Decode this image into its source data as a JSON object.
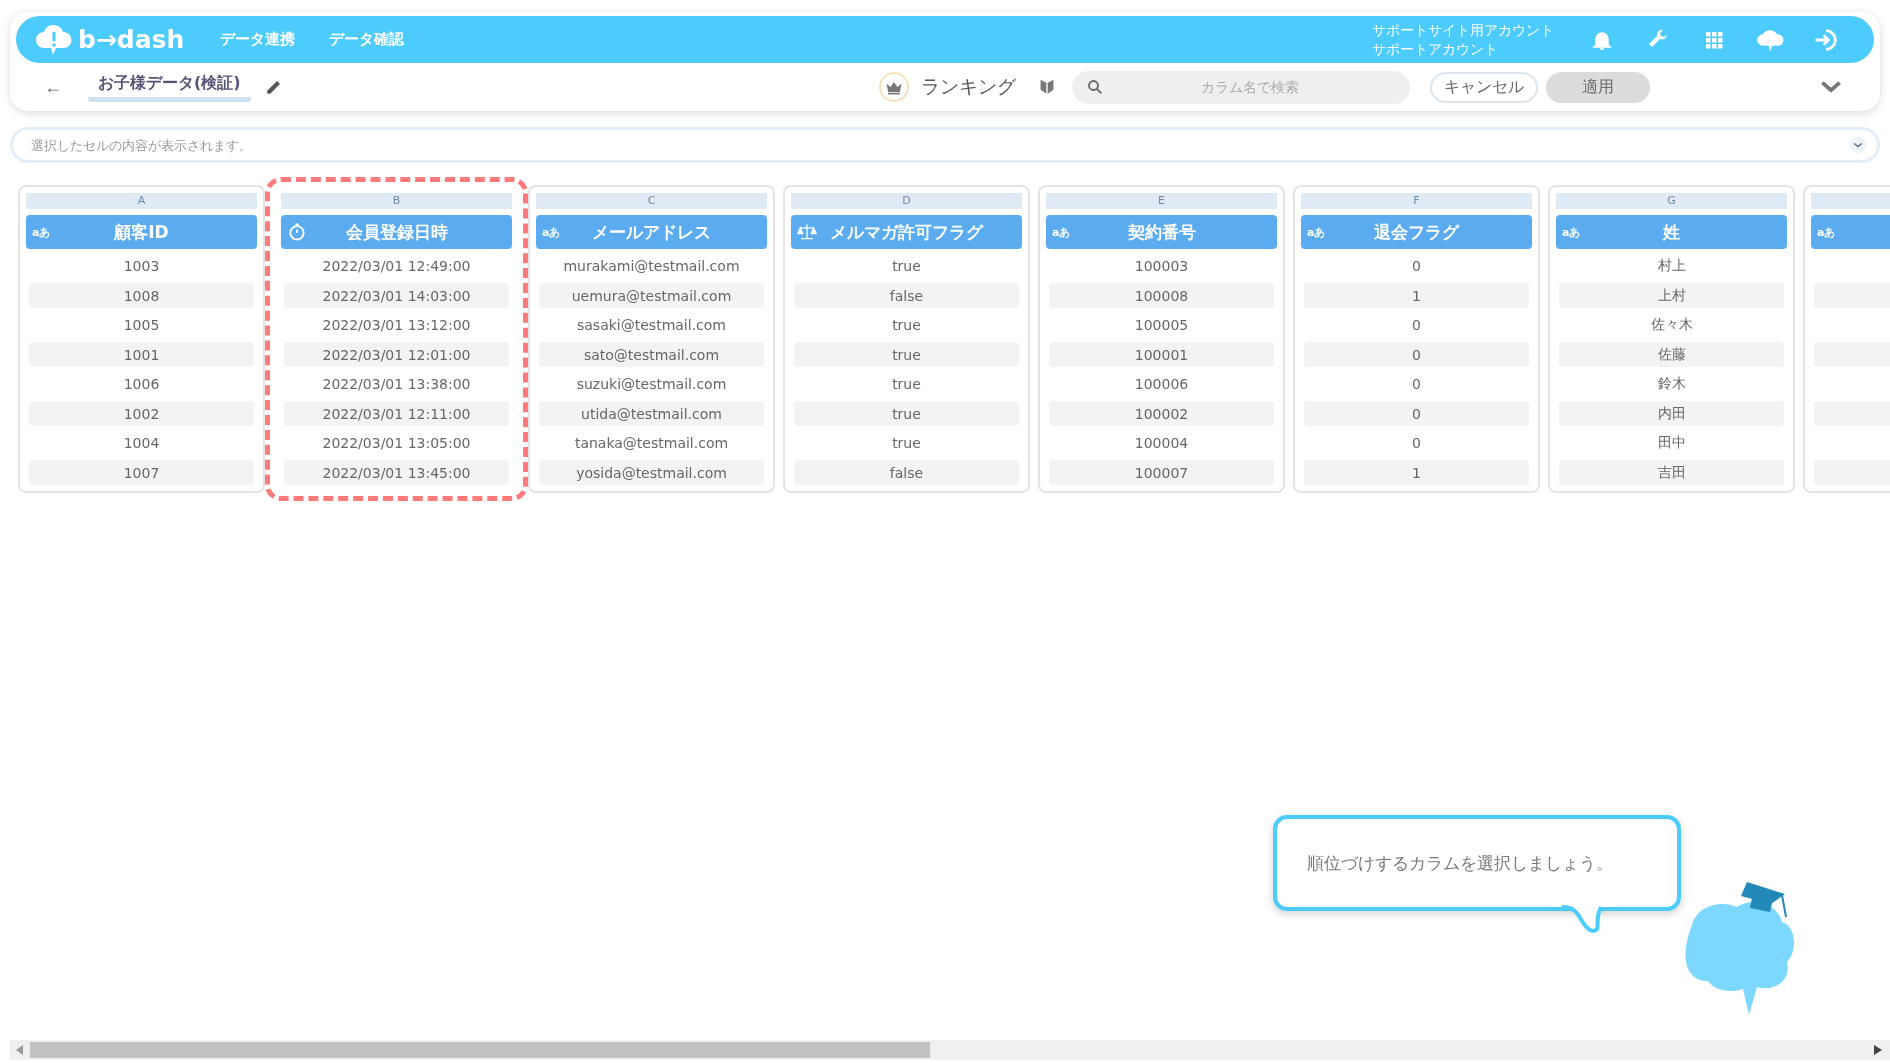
{
  "header": {
    "logo": "b→dash",
    "nav": [
      {
        "label": "データ連携"
      },
      {
        "label": "データ確認"
      }
    ],
    "account": {
      "site": "サポートサイト用アカウント",
      "name": "サポートアカウント"
    }
  },
  "toolbar": {
    "back": "←",
    "title": "お子様データ(検証)",
    "mode": "ランキング",
    "search": {
      "placeholder": "カラム名で検索"
    },
    "cancel": "キャンセル",
    "apply": {
      "label": "適用",
      "disabled": true
    }
  },
  "cell_viewer": {
    "placeholder": "選択したセルの内容が表示されます。"
  },
  "columns": [
    {
      "letter": "A",
      "label": "顧客ID",
      "kind": "text",
      "type_glyph": "aあ",
      "highlighted": false,
      "cells": [
        "1003",
        "1008",
        "1005",
        "1001",
        "1006",
        "1002",
        "1004",
        "1007"
      ]
    },
    {
      "letter": "B",
      "label": "会員登録日時",
      "kind": "datetime",
      "highlighted": true,
      "cells": [
        "2022/03/01 12:49:00",
        "2022/03/01 14:03:00",
        "2022/03/01 13:12:00",
        "2022/03/01 12:01:00",
        "2022/03/01 13:38:00",
        "2022/03/01 12:11:00",
        "2022/03/01 13:05:00",
        "2022/03/01 13:45:00"
      ]
    },
    {
      "letter": "C",
      "label": "メールアドレス",
      "kind": "text",
      "type_glyph": "aあ",
      "highlighted": false,
      "cells": [
        "murakami@testmail.com",
        "uemura@testmail.com",
        "sasaki@testmail.com",
        "sato@testmail.com",
        "suzuki@testmail.com",
        "utida@testmail.com",
        "tanaka@testmail.com",
        "yosida@testmail.com"
      ]
    },
    {
      "letter": "D",
      "label": "メルマガ許可フラグ",
      "kind": "boolean",
      "highlighted": false,
      "cells": [
        "true",
        "false",
        "true",
        "true",
        "true",
        "true",
        "true",
        "false"
      ]
    },
    {
      "letter": "E",
      "label": "契約番号",
      "kind": "text",
      "type_glyph": "aあ",
      "highlighted": false,
      "cells": [
        "100003",
        "100008",
        "100005",
        "100001",
        "100006",
        "100002",
        "100004",
        "100007"
      ]
    },
    {
      "letter": "F",
      "label": "退会フラグ",
      "kind": "text",
      "type_glyph": "aあ",
      "highlighted": false,
      "cells": [
        "0",
        "1",
        "0",
        "0",
        "0",
        "0",
        "0",
        "1"
      ]
    },
    {
      "letter": "G",
      "label": "姓",
      "kind": "text",
      "type_glyph": "aあ",
      "highlighted": false,
      "cells": [
        "村上",
        "上村",
        "佐々木",
        "佐藤",
        "鈴木",
        "内田",
        "田中",
        "吉田"
      ]
    },
    {
      "kind": "text",
      "type_glyph": "aあ",
      "highlighted": false
    }
  ],
  "hint": {
    "message": "順位づけするカラムを選択しましょう。"
  }
}
